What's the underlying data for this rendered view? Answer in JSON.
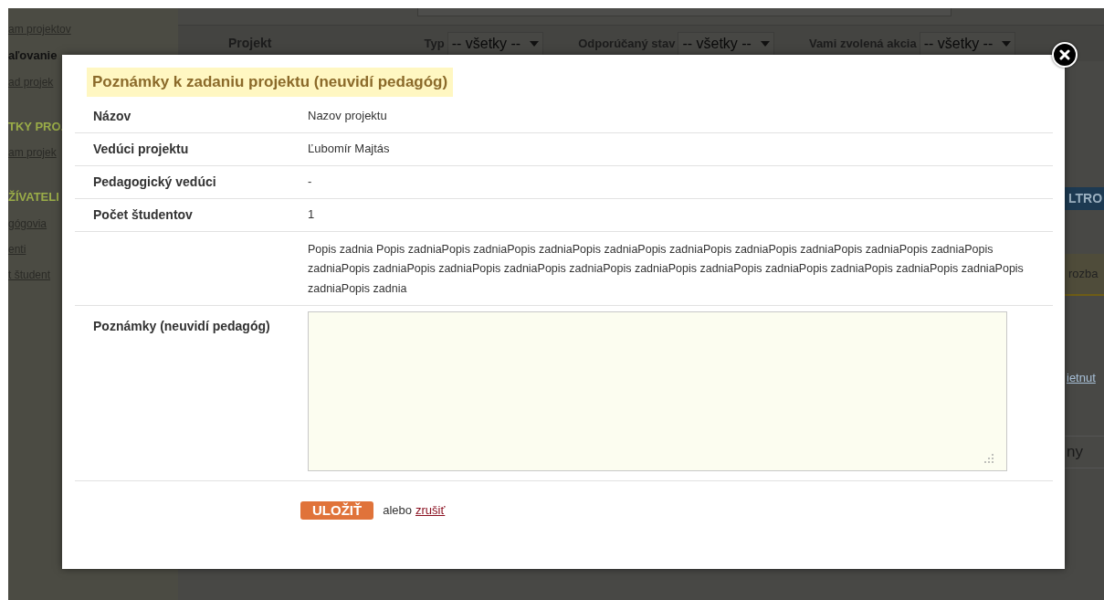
{
  "background": {
    "sidebar_items": [
      {
        "text": "am projektov",
        "kind": "link"
      },
      {
        "text": "aľovanie",
        "kind": "bold"
      },
      {
        "text": "ad projek",
        "kind": "link"
      },
      {
        "text": "TKY PRO.",
        "kind": "heading"
      },
      {
        "text": "am projek",
        "kind": "link"
      },
      {
        "text": "ŽÍVATELI",
        "kind": "heading"
      },
      {
        "text": "gógovia",
        "kind": "link"
      },
      {
        "text": "enti",
        "kind": "link"
      },
      {
        "text": "t študent",
        "kind": "link"
      }
    ],
    "filter_bar": {
      "project_label": "Projekt",
      "filters": [
        {
          "label": "Typ",
          "value": "-- všetky --"
        },
        {
          "label": "Odporúčaný stav",
          "value": "-- všetky --"
        },
        {
          "label": "Vami zvolená akcia",
          "value": "-- všetky --"
        }
      ]
    },
    "right_edge": [
      {
        "text": "LTRO",
        "kind": "button"
      },
      {
        "text": "rozba",
        "kind": "notice"
      },
      {
        "text": "ietnut",
        "kind": "link"
      },
      {
        "text": "ny",
        "kind": "text"
      }
    ]
  },
  "modal": {
    "title": "Poznámky k zadaniu projektu (neuvidí pedagóg)",
    "fields": [
      {
        "label": "Názov",
        "value": "Nazov projektu"
      },
      {
        "label": "Vedúci projektu",
        "value": "Ľubomír Majtás"
      },
      {
        "label": "Pedagogický vedúci",
        "value": "-"
      },
      {
        "label": "Počet študentov",
        "value": "1"
      }
    ],
    "description": "Popis zadnia Popis zadniaPopis zadniaPopis zadniaPopis zadniaPopis zadniaPopis zadniaPopis zadniaPopis zadniaPopis zadniaPopis zadniaPopis zadniaPopis zadniaPopis zadniaPopis zadniaPopis zadniaPopis zadniaPopis zadniaPopis zadniaPopis zadniaPopis zadniaPopis zadniaPopis zadnia",
    "notes_label": "Poznámky (neuvidí pedagóg)",
    "save_button": "ULOŽIŤ",
    "or_text": "alebo",
    "cancel_link": "zrušiť"
  }
}
